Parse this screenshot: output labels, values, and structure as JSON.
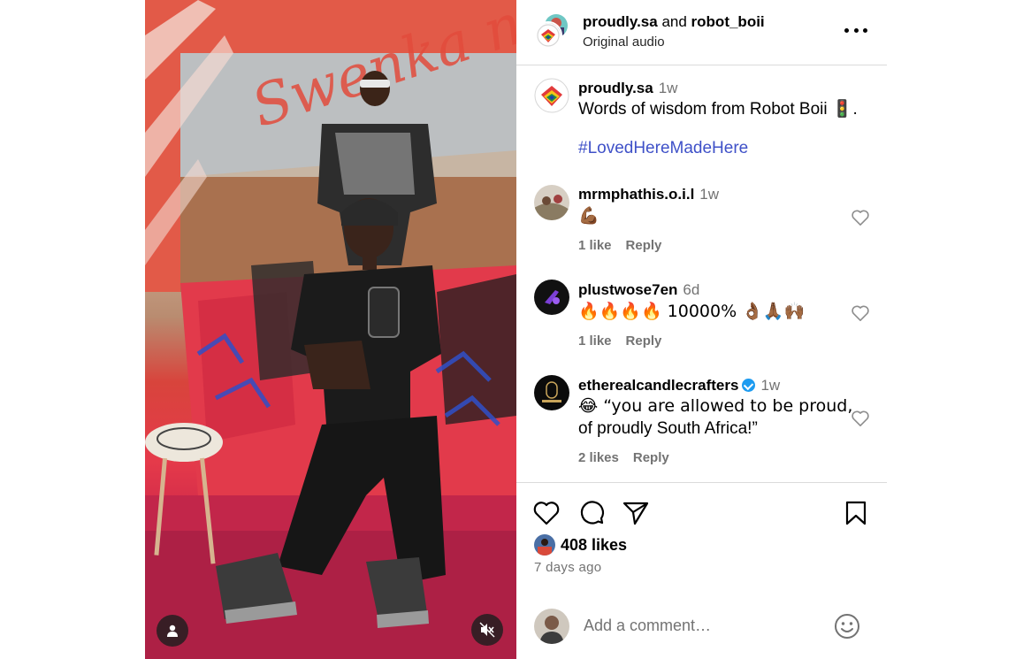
{
  "media": {
    "backdrop_script_text": "Swenka ngendocal",
    "user_button_icon": "user-icon",
    "mute_button_icon": "speaker-muted-icon"
  },
  "header": {
    "account_1": "proudly.sa",
    "joiner": "and",
    "account_2": "robot_boii",
    "audio": "Original audio",
    "more_icon": "more-horizontal-icon"
  },
  "caption": {
    "username": "proudly.sa",
    "time": "1w",
    "text": "Words of wisdom from Robot Boii 🚦.",
    "hashtag": "#LovedHereMadeHere"
  },
  "comments": [
    {
      "username": "mrmphathis.o.i.l",
      "time": "1w",
      "text": "💪🏾",
      "likes": "1 like",
      "reply": "Reply",
      "verified": false
    },
    {
      "username": "plustwose7en",
      "time": "6d",
      "text": "🔥🔥🔥🔥 10000% 👌🏾🙏🏾🙌🏾",
      "likes": "1 like",
      "reply": "Reply",
      "verified": false
    },
    {
      "username": "etherealcandlecrafters",
      "time": "1w",
      "text_line1": "😂 “you are allowed to be proud,",
      "text_line2": "of proudly South Africa!”",
      "likes": "2 likes",
      "reply": "Reply",
      "verified": true
    }
  ],
  "actions": {
    "like_icon": "heart-icon",
    "comment_icon": "comment-icon",
    "share_icon": "paper-plane-icon",
    "save_icon": "bookmark-icon"
  },
  "likes_count": "408 likes",
  "posted": "7 days ago",
  "add_comment": {
    "placeholder": "Add a comment…",
    "emoji_icon": "smiley-icon"
  },
  "colors": {
    "hashtag": "#3f51c8",
    "verified": "#1d9bf0",
    "muted_text": "#737373",
    "divider": "#dbdbdb"
  }
}
